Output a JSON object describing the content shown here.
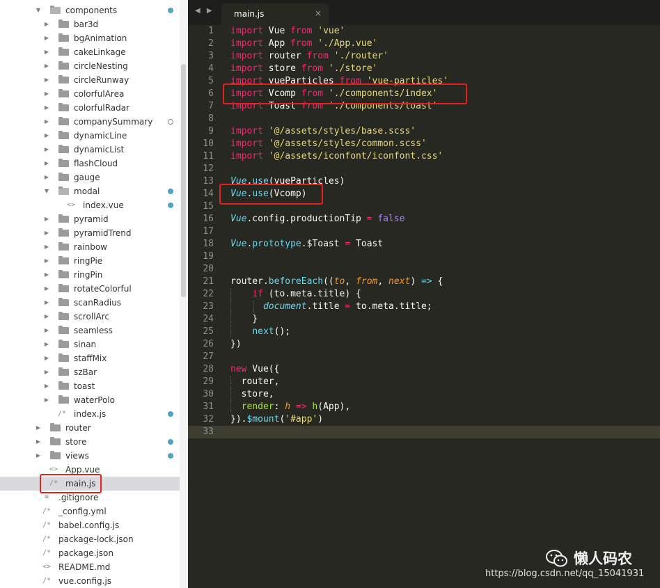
{
  "sidebar": {
    "rows": [
      {
        "label": "components",
        "type": "folder",
        "expand": "open",
        "depth": 1,
        "dot": "filled"
      },
      {
        "label": "bar3d",
        "type": "folder",
        "expand": "closed",
        "depth": 2
      },
      {
        "label": "bgAnimation",
        "type": "folder",
        "expand": "closed",
        "depth": 2
      },
      {
        "label": "cakeLinkage",
        "type": "folder",
        "expand": "closed",
        "depth": 2
      },
      {
        "label": "circleNesting",
        "type": "folder",
        "expand": "closed",
        "depth": 2
      },
      {
        "label": "circleRunway",
        "type": "folder",
        "expand": "closed",
        "depth": 2
      },
      {
        "label": "colorfulArea",
        "type": "folder",
        "expand": "closed",
        "depth": 2
      },
      {
        "label": "colorfulRadar",
        "type": "folder",
        "expand": "closed",
        "depth": 2
      },
      {
        "label": "companySummary",
        "type": "folder",
        "expand": "closed",
        "depth": 2,
        "dot": "hollow"
      },
      {
        "label": "dynamicLine",
        "type": "folder",
        "expand": "closed",
        "depth": 2
      },
      {
        "label": "dynamicList",
        "type": "folder",
        "expand": "closed",
        "depth": 2
      },
      {
        "label": "flashCloud",
        "type": "folder",
        "expand": "closed",
        "depth": 2
      },
      {
        "label": "gauge",
        "type": "folder",
        "expand": "closed",
        "depth": 2
      },
      {
        "label": "modal",
        "type": "folder",
        "expand": "open",
        "depth": 2,
        "dot": "filled"
      },
      {
        "label": "index.vue",
        "type": "file",
        "glyph": "<>",
        "depth": 3,
        "dot": "filled"
      },
      {
        "label": "pyramid",
        "type": "folder",
        "expand": "closed",
        "depth": 2
      },
      {
        "label": "pyramidTrend",
        "type": "folder",
        "expand": "closed",
        "depth": 2
      },
      {
        "label": "rainbow",
        "type": "folder",
        "expand": "closed",
        "depth": 2
      },
      {
        "label": "ringPie",
        "type": "folder",
        "expand": "closed",
        "depth": 2
      },
      {
        "label": "ringPin",
        "type": "folder",
        "expand": "closed",
        "depth": 2
      },
      {
        "label": "rotateColorful",
        "type": "folder",
        "expand": "closed",
        "depth": 2
      },
      {
        "label": "scanRadius",
        "type": "folder",
        "expand": "closed",
        "depth": 2
      },
      {
        "label": "scrollArc",
        "type": "folder",
        "expand": "closed",
        "depth": 2
      },
      {
        "label": "seamless",
        "type": "folder",
        "expand": "closed",
        "depth": 2
      },
      {
        "label": "sinan",
        "type": "folder",
        "expand": "closed",
        "depth": 2
      },
      {
        "label": "staffMix",
        "type": "folder",
        "expand": "closed",
        "depth": 2
      },
      {
        "label": "szBar",
        "type": "folder",
        "expand": "closed",
        "depth": 2
      },
      {
        "label": "toast",
        "type": "folder",
        "expand": "closed",
        "depth": 2
      },
      {
        "label": "waterPolo",
        "type": "folder",
        "expand": "closed",
        "depth": 2
      },
      {
        "label": "index.js",
        "type": "file",
        "glyph": "/*",
        "depth": 2,
        "dot": "filled"
      },
      {
        "label": "router",
        "type": "folder",
        "expand": "closed",
        "depth": 1
      },
      {
        "label": "store",
        "type": "folder",
        "expand": "closed",
        "depth": 1,
        "dot": "filled"
      },
      {
        "label": "views",
        "type": "folder",
        "expand": "closed",
        "depth": 1,
        "dot": "filled"
      },
      {
        "label": "App.vue",
        "type": "file",
        "glyph": "<>",
        "depth": 1
      },
      {
        "label": "main.js",
        "type": "file",
        "glyph": "/*",
        "depth": 1,
        "selected": true,
        "highlighted": true
      },
      {
        "label": ".gitignore",
        "type": "file",
        "glyph": "≡",
        "depth": 0
      },
      {
        "label": "_config.yml",
        "type": "file",
        "glyph": "/*",
        "depth": 0
      },
      {
        "label": "babel.config.js",
        "type": "file",
        "glyph": "/*",
        "depth": 0
      },
      {
        "label": "package-lock.json",
        "type": "file",
        "glyph": "/*",
        "depth": 0
      },
      {
        "label": "package.json",
        "type": "file",
        "glyph": "/*",
        "depth": 0
      },
      {
        "label": "README.md",
        "type": "file",
        "glyph": "<>",
        "depth": 0
      },
      {
        "label": "vue.config.js",
        "type": "file",
        "glyph": "/*",
        "depth": 0
      }
    ]
  },
  "editor": {
    "nav_arrows": "◀ ▶",
    "tab_title": "main.js",
    "tab_close": "×",
    "current_line": 33,
    "highlighted_lines": [
      6,
      14
    ],
    "lines": [
      [
        [
          "k",
          "import"
        ],
        [
          "t",
          " Vue "
        ],
        [
          "k",
          "from"
        ],
        [
          "t",
          " "
        ],
        [
          "s",
          "'vue'"
        ]
      ],
      [
        [
          "k",
          "import"
        ],
        [
          "t",
          " App "
        ],
        [
          "k",
          "from"
        ],
        [
          "t",
          " "
        ],
        [
          "s",
          "'./App.vue'"
        ]
      ],
      [
        [
          "k",
          "import"
        ],
        [
          "t",
          " router "
        ],
        [
          "k",
          "from"
        ],
        [
          "t",
          " "
        ],
        [
          "s",
          "'./router'"
        ]
      ],
      [
        [
          "k",
          "import"
        ],
        [
          "t",
          " store "
        ],
        [
          "k",
          "from"
        ],
        [
          "t",
          " "
        ],
        [
          "s",
          "'./store'"
        ]
      ],
      [
        [
          "k",
          "import"
        ],
        [
          "t",
          " vueParticles "
        ],
        [
          "k",
          "from"
        ],
        [
          "t",
          " "
        ],
        [
          "s",
          "'vue-particles'"
        ]
      ],
      [
        [
          "k",
          "import"
        ],
        [
          "t",
          " Vcomp "
        ],
        [
          "k",
          "from"
        ],
        [
          "t",
          " "
        ],
        [
          "s",
          "'./components/index'"
        ]
      ],
      [
        [
          "k",
          "import"
        ],
        [
          "t",
          " Toast "
        ],
        [
          "k",
          "from"
        ],
        [
          "t",
          " "
        ],
        [
          "s",
          "'./components/toast'"
        ]
      ],
      [],
      [
        [
          "k",
          "import"
        ],
        [
          "t",
          " "
        ],
        [
          "s",
          "'@/assets/styles/base.scss'"
        ]
      ],
      [
        [
          "k",
          "import"
        ],
        [
          "t",
          " "
        ],
        [
          "s",
          "'@/assets/styles/common.scss'"
        ]
      ],
      [
        [
          "k",
          "import"
        ],
        [
          "t",
          " "
        ],
        [
          "s",
          "'@/assets/iconfont/iconfont.css'"
        ]
      ],
      [],
      [
        [
          "v",
          "Vue"
        ],
        [
          "t",
          "."
        ],
        [
          "f",
          "use"
        ],
        [
          "t",
          "(vueParticles)"
        ]
      ],
      [
        [
          "v",
          "Vue"
        ],
        [
          "t",
          "."
        ],
        [
          "f",
          "use"
        ],
        [
          "t",
          "(Vcomp)"
        ]
      ],
      [],
      [
        [
          "v",
          "Vue"
        ],
        [
          "t",
          ".config.productionTip "
        ],
        [
          "k",
          "="
        ],
        [
          "t",
          " "
        ],
        [
          "n",
          "false"
        ]
      ],
      [],
      [
        [
          "v",
          "Vue"
        ],
        [
          "t",
          "."
        ],
        [
          "f",
          "prototype"
        ],
        [
          "t",
          ".$Toast "
        ],
        [
          "k",
          "="
        ],
        [
          "t",
          " Toast"
        ]
      ],
      [],
      [],
      [
        [
          "t",
          "router."
        ],
        [
          "f",
          "beforeEach"
        ],
        [
          "t",
          "(("
        ],
        [
          "p",
          "to"
        ],
        [
          "t",
          ", "
        ],
        [
          "p",
          "from"
        ],
        [
          "t",
          ", "
        ],
        [
          "p",
          "next"
        ],
        [
          "t",
          ") "
        ],
        [
          "f",
          "=>"
        ],
        [
          "t",
          " {"
        ]
      ],
      [
        [
          "t",
          "    "
        ],
        [
          "k",
          "if"
        ],
        [
          "t",
          " (to.meta.title) {"
        ]
      ],
      [
        [
          "t",
          "      "
        ],
        [
          "v",
          "document"
        ],
        [
          "t",
          ".title "
        ],
        [
          "k",
          "="
        ],
        [
          "t",
          " to.meta.title;"
        ]
      ],
      [
        [
          "t",
          "    }"
        ]
      ],
      [
        [
          "t",
          "    "
        ],
        [
          "f",
          "next"
        ],
        [
          "t",
          "();"
        ]
      ],
      [
        [
          "t",
          "})"
        ]
      ],
      [],
      [
        [
          "k",
          "new"
        ],
        [
          "t",
          " Vue({"
        ]
      ],
      [
        [
          "t",
          "  router,"
        ]
      ],
      [
        [
          "t",
          "  store,"
        ]
      ],
      [
        [
          "t",
          "  "
        ],
        [
          "g",
          "render"
        ],
        [
          "t",
          ": "
        ],
        [
          "p",
          "h"
        ],
        [
          "t",
          " "
        ],
        [
          "k",
          "=>"
        ],
        [
          "t",
          " "
        ],
        [
          "g",
          "h"
        ],
        [
          "t",
          "(App),"
        ]
      ],
      [
        [
          "t",
          "})."
        ],
        [
          "f",
          "$mount"
        ],
        [
          "t",
          "("
        ],
        [
          "s",
          "'#app'"
        ],
        [
          "t",
          ")"
        ]
      ],
      []
    ]
  },
  "watermark": {
    "brand": "懒人码农",
    "url": "https://blog.csdn.net/qq_15041931"
  },
  "colors": {
    "editor_bg": "#272822",
    "keyword": "#f92672",
    "string": "#e6db74",
    "builtin": "#66d9ef",
    "param": "#fd971f",
    "constant": "#ae81ff",
    "highlight_box": "#e8211f",
    "modified_dot": "#4fa4c4"
  }
}
